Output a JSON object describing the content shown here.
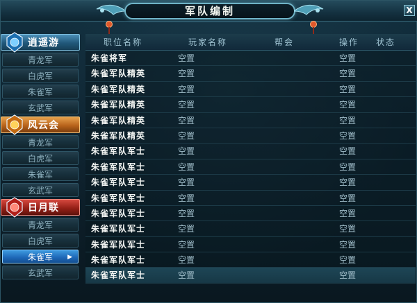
{
  "window": {
    "title": "军队编制",
    "close_label": "X",
    "accent_color": "#6fb3c7"
  },
  "sidebar": {
    "groups": [
      {
        "name": "逍遥游",
        "style": "blue",
        "icon": "blue-gem-icon",
        "items": [
          "青龙军",
          "白虎军",
          "朱雀军",
          "玄武军"
        ]
      },
      {
        "name": "风云会",
        "style": "orange",
        "icon": "orange-gem-icon",
        "items": [
          "青龙军",
          "白虎军",
          "朱雀军",
          "玄武军"
        ]
      },
      {
        "name": "日月联",
        "style": "red",
        "icon": "red-gem-icon",
        "items": [
          "青龙军",
          "白虎军",
          "朱雀军",
          "玄武军"
        ]
      }
    ],
    "active_item": "朱雀军",
    "active_group": "日月联"
  },
  "table": {
    "headers": {
      "position": "职位名称",
      "player": "玩家名称",
      "guild": "帮会",
      "action": "操作",
      "status": "状态"
    },
    "rows": [
      {
        "position": "朱雀将军",
        "player": "空置",
        "guild": "",
        "action": "空置",
        "status": ""
      },
      {
        "position": "朱雀军队精英",
        "player": "空置",
        "guild": "",
        "action": "空置",
        "status": ""
      },
      {
        "position": "朱雀军队精英",
        "player": "空置",
        "guild": "",
        "action": "空置",
        "status": ""
      },
      {
        "position": "朱雀军队精英",
        "player": "空置",
        "guild": "",
        "action": "空置",
        "status": ""
      },
      {
        "position": "朱雀军队精英",
        "player": "空置",
        "guild": "",
        "action": "空置",
        "status": ""
      },
      {
        "position": "朱雀军队精英",
        "player": "空置",
        "guild": "",
        "action": "空置",
        "status": ""
      },
      {
        "position": "朱雀军队军士",
        "player": "空置",
        "guild": "",
        "action": "空置",
        "status": ""
      },
      {
        "position": "朱雀军队军士",
        "player": "空置",
        "guild": "",
        "action": "空置",
        "status": ""
      },
      {
        "position": "朱雀军队军士",
        "player": "空置",
        "guild": "",
        "action": "空置",
        "status": ""
      },
      {
        "position": "朱雀军队军士",
        "player": "空置",
        "guild": "",
        "action": "空置",
        "status": ""
      },
      {
        "position": "朱雀军队军士",
        "player": "空置",
        "guild": "",
        "action": "空置",
        "status": ""
      },
      {
        "position": "朱雀军队军士",
        "player": "空置",
        "guild": "",
        "action": "空置",
        "status": ""
      },
      {
        "position": "朱雀军队军士",
        "player": "空置",
        "guild": "",
        "action": "空置",
        "status": ""
      },
      {
        "position": "朱雀军队军士",
        "player": "空置",
        "guild": "",
        "action": "空置",
        "status": ""
      },
      {
        "position": "朱雀军队军士",
        "player": "空置",
        "guild": "",
        "action": "空置",
        "status": ""
      }
    ],
    "selected_row": 14
  }
}
